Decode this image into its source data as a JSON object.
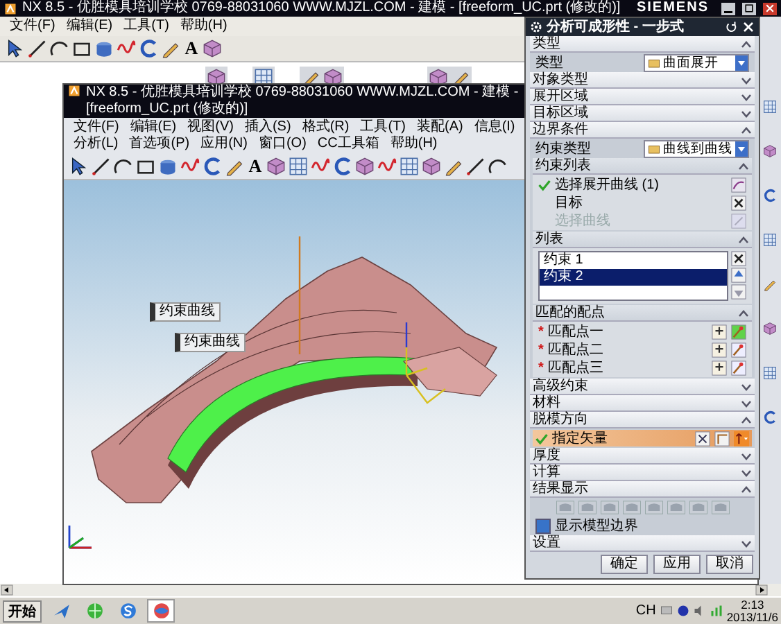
{
  "back_window": {
    "title": "NX 8.5 - 优胜模具培训学校 0769-88031060 WWW.MJZL.COM - 建模 - [freeform_UC.prt (修改的)]",
    "brand": "SIEMENS",
    "menu": [
      "文件(F)",
      "编辑(E)",
      "工具(T)",
      "帮助(H)"
    ],
    "toolbar": [
      {
        "kind": "select"
      },
      {
        "kind": "line"
      },
      {
        "kind": "arc"
      },
      {
        "kind": "rectangle"
      },
      {
        "kind": "solid"
      },
      {
        "kind": "spline"
      },
      {
        "kind": "curve"
      },
      {
        "kind": "sketch"
      },
      {
        "kind": "text",
        "label": "A"
      },
      {
        "kind": "cube"
      }
    ],
    "quick_tools": [
      {
        "tools": [
          {
            "kind": "cube"
          }
        ]
      },
      {
        "tools": [
          {
            "kind": "grid"
          }
        ]
      },
      {
        "tools": [
          {
            "kind": "sketch"
          },
          {
            "kind": "cube"
          }
        ]
      },
      {
        "tools": [
          {
            "kind": "cube"
          },
          {
            "kind": "sketch"
          }
        ]
      }
    ]
  },
  "main_window": {
    "title": "NX 8.5 - 优胜模具培训学校 0769-88031060 WWW.MJZL.COM - 建模 - [freeform_UC.prt (修改的)]",
    "menu": [
      "文件(F)",
      "编辑(E)",
      "视图(V)",
      "插入(S)",
      "格式(R)",
      "工具(T)",
      "装配(A)",
      "信息(I)",
      "分析(L)",
      "首选项(P)",
      "应用(N)",
      "窗口(O)",
      "CC工具箱",
      "帮助(H)"
    ],
    "toolbar": [
      {
        "kind": "select"
      },
      {
        "kind": "line"
      },
      {
        "kind": "arc"
      },
      {
        "kind": "rectangle"
      },
      {
        "kind": "solid"
      },
      {
        "kind": "spline"
      },
      {
        "kind": "curve"
      },
      {
        "kind": "sketch"
      },
      {
        "kind": "text",
        "label": "A"
      },
      {
        "kind": "cube"
      },
      {
        "kind": "grid"
      },
      {
        "kind": "spline"
      },
      {
        "kind": "curve"
      },
      {
        "kind": "cube"
      },
      {
        "kind": "spline"
      },
      {
        "kind": "grid"
      },
      {
        "kind": "cube"
      },
      {
        "kind": "sketch"
      },
      {
        "kind": "line"
      },
      {
        "kind": "arc"
      }
    ],
    "viewport": {
      "labels": [
        "约束曲线",
        "约束曲线"
      ]
    }
  },
  "dialog": {
    "title": "分析可成形性 - 一步式",
    "sections": [
      {
        "label": "类型",
        "expanded": true,
        "rows": [
          {
            "kind": "dropdown",
            "label": "类型",
            "value": "曲面展开"
          }
        ]
      },
      {
        "label": "对象类型",
        "expanded": false
      },
      {
        "label": "展开区域",
        "expanded": false
      },
      {
        "label": "目标区域",
        "expanded": false
      },
      {
        "label": "边界条件",
        "expanded": true,
        "rows": [
          {
            "kind": "dropdown",
            "label": "约束类型",
            "value": "曲线到曲线"
          },
          {
            "kind": "group",
            "label": "约束列表",
            "expanded": true,
            "rows": [
              {
                "kind": "select",
                "label": "选择展开曲线 (1)",
                "complete": true,
                "disabled": false
              },
              {
                "kind": "select",
                "label": "目标",
                "complete": false,
                "disabled": false
              },
              {
                "kind": "select",
                "label": "选择曲线",
                "complete": false,
                "disabled": true
              }
            ]
          },
          {
            "kind": "group",
            "label": "列表",
            "expanded": true,
            "rows": [
              {
                "kind": "list",
                "items": [
                  {
                    "label": "约束 1",
                    "selected": false
                  },
                  {
                    "label": "约束 2",
                    "selected": true
                  }
                ]
              }
            ]
          },
          {
            "kind": "group",
            "label": "匹配的配点",
            "expanded": true,
            "rows": [
              {
                "kind": "point",
                "marker": "*",
                "label": "匹配点一",
                "active": true
              },
              {
                "kind": "point",
                "marker": "*",
                "label": "匹配点二",
                "active": false
              },
              {
                "kind": "point",
                "marker": "*",
                "label": "匹配点三",
                "active": false
              }
            ]
          }
        ]
      },
      {
        "label": "高级约束",
        "expanded": false
      },
      {
        "label": "材料",
        "expanded": false
      },
      {
        "label": "脱模方向",
        "expanded": true,
        "rows": [
          {
            "kind": "vector",
            "label": "指定矢量",
            "complete": true,
            "active": true
          }
        ]
      },
      {
        "label": "厚度",
        "expanded": false
      },
      {
        "label": "计算",
        "expanded": false
      },
      {
        "label": "结果显示",
        "expanded": true,
        "rows": [
          {
            "kind": "shade_buttons"
          },
          {
            "kind": "checkbox",
            "label": "显示模型边界",
            "checked": true
          }
        ]
      },
      {
        "label": "设置",
        "expanded": false
      }
    ],
    "buttons": [
      "确定",
      "应用",
      "取消"
    ]
  },
  "taskbar": {
    "start": "开始",
    "apps": [
      {
        "kind": "plane",
        "selected": false
      },
      {
        "kind": "globe",
        "selected": false
      },
      {
        "kind": "swirl",
        "selected": false
      },
      {
        "kind": "ball",
        "selected": true
      }
    ],
    "language": "CH",
    "time": "2:13",
    "date": "2013/11/6"
  }
}
